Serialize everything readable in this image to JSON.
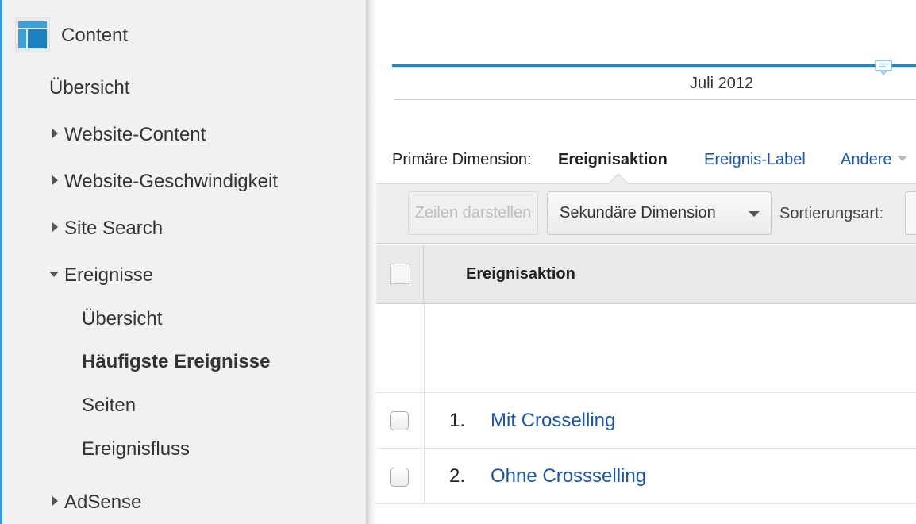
{
  "sidebar": {
    "title": "Content",
    "items": [
      {
        "label": "Übersicht"
      },
      {
        "label": "Website-Content"
      },
      {
        "label": "Website-Geschwindigkeit"
      },
      {
        "label": "Site Search"
      },
      {
        "label": "Ereignisse"
      },
      {
        "label": "Übersicht"
      },
      {
        "label": "Häufigste Ereignisse"
      },
      {
        "label": "Seiten"
      },
      {
        "label": "Ereignisfluss"
      },
      {
        "label": "AdSense"
      }
    ]
  },
  "timeline": {
    "label": "Juli 2012"
  },
  "dimensions": {
    "label": "Primäre Dimension:",
    "active": "Ereignisaktion",
    "link": "Ereignis-Label",
    "other": "Andere"
  },
  "toolbar": {
    "plot_rows": "Zeilen darstellen",
    "secondary_dimension": "Sekundäre Dimension",
    "sort_label": "Sortierungsart:"
  },
  "table": {
    "column_header": "Ereignisaktion",
    "rows": [
      {
        "num": "1.",
        "label": "Mit Crosselling"
      },
      {
        "num": "2.",
        "label": "Ohne Crossselling"
      }
    ]
  },
  "colors": {
    "accent": "#1b8bcf",
    "link": "#1a56b0"
  }
}
